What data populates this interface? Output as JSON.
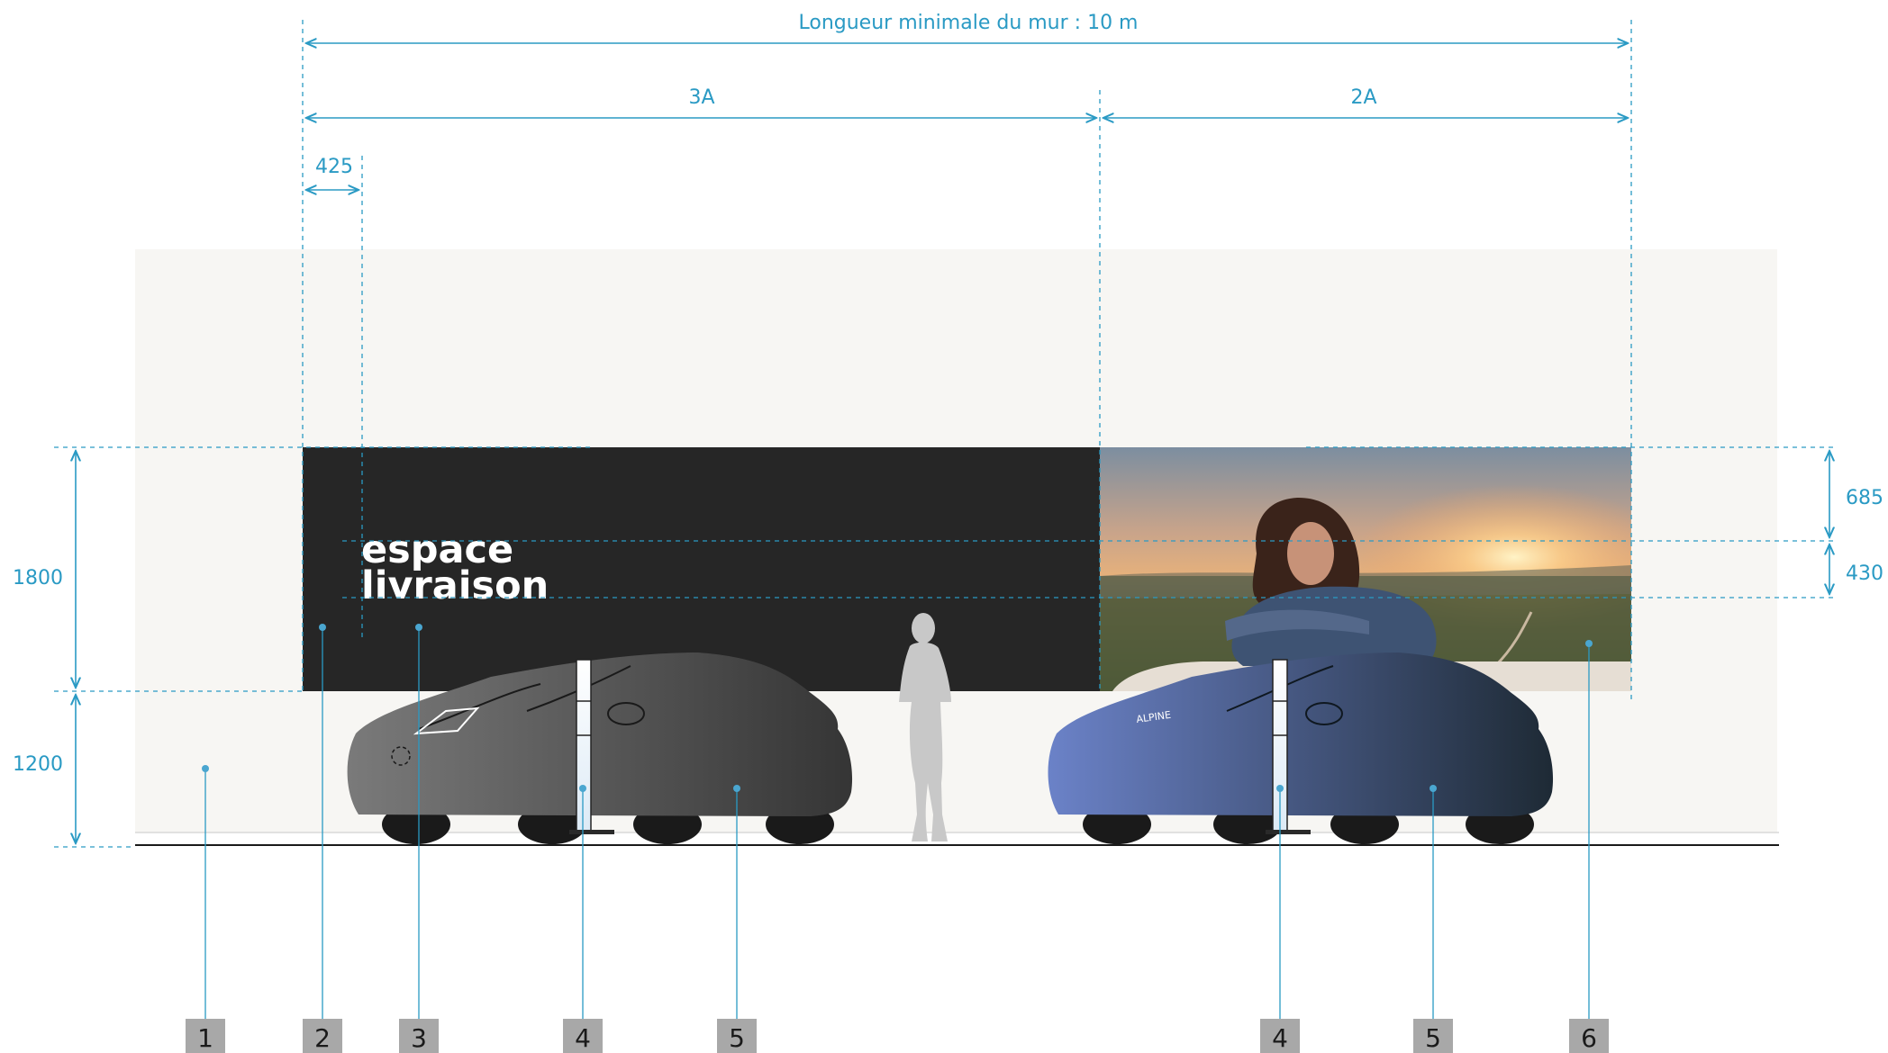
{
  "dimensions": {
    "wall_length": "Longueur minimale du mur : 10 m",
    "left_section": "3A",
    "right_section": "2A",
    "logo_offset": "425",
    "panel_height": "1800",
    "base_height": "1200",
    "image_top": "685",
    "image_mid": "430"
  },
  "panel": {
    "title_line1": "espace",
    "title_line2": "livraison"
  },
  "car_right_brand": "ALPINE",
  "legend": [
    "1",
    "2",
    "3",
    "4",
    "5",
    "4",
    "5",
    "6"
  ],
  "colors": {
    "dimension": "#2a9ac4",
    "wall": "#f7f6f3",
    "panel": "#262626",
    "legend_box": "#a8a8a8",
    "car_left": "#4a4a4a",
    "car_right": "#4c5f93"
  },
  "icons": {
    "figure": "person-silhouette-icon",
    "bollard": "charging-bollard-icon"
  }
}
